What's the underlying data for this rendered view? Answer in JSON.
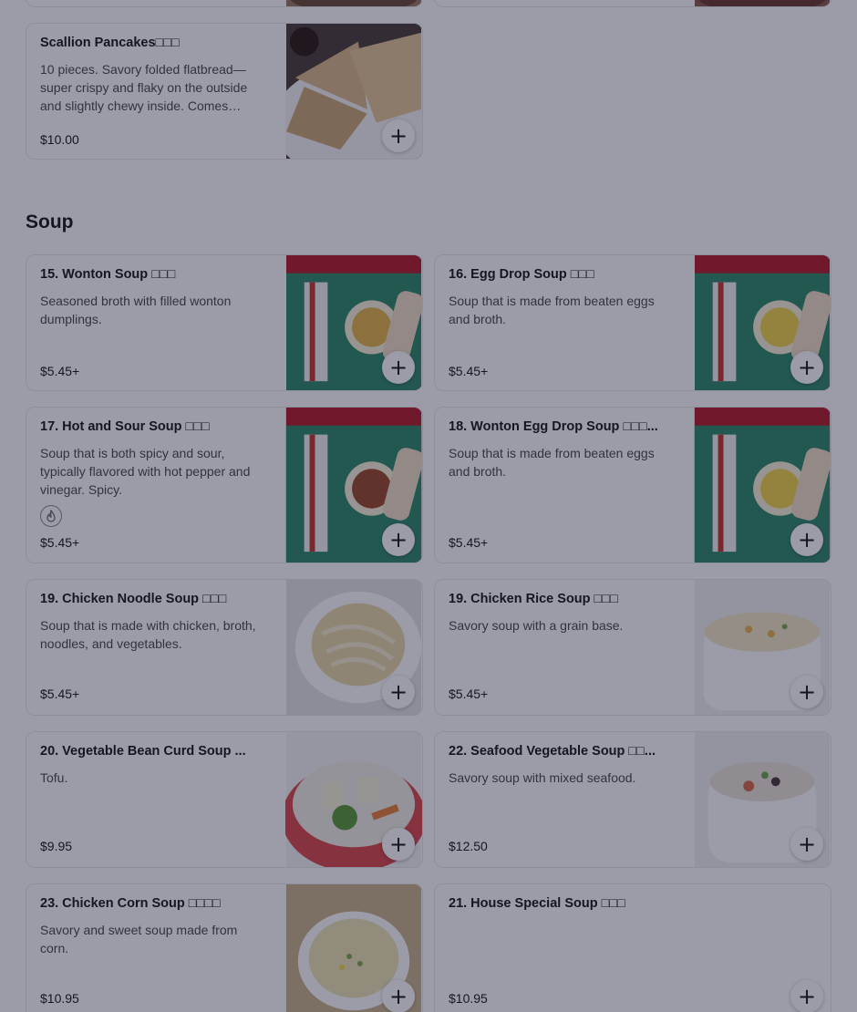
{
  "top_items": [
    {
      "name": "Scallion Pancakes   ",
      "name_suffix": "□□□",
      "description": "10 pieces. Savory folded flatbread—super crispy and flaky on the outside and slightly chewy inside. Comes…",
      "price": "$10.00"
    }
  ],
  "section": {
    "title": "Soup"
  },
  "items": [
    {
      "name": "15. Wonton Soup □□□",
      "description": "Seasoned broth with filled wonton dumplings.",
      "price": "$5.45+"
    },
    {
      "name": "16. Egg Drop Soup □□□",
      "description": "Soup that is made from beaten eggs and broth.",
      "price": "$5.45+"
    },
    {
      "name": "17. Hot and Sour Soup □□□",
      "description": "Soup that is both spicy and sour, typically flavored with hot pepper and vinegar. Spicy.",
      "price": "$5.45+"
    },
    {
      "name": "18. Wonton Egg Drop Soup □□□...",
      "description": "Soup that is made from beaten eggs and broth.",
      "price": "$5.45+"
    },
    {
      "name": "19. Chicken Noodle Soup □□□",
      "description": "Soup that is made with chicken, broth, noodles, and vegetables.",
      "price": "$5.45+"
    },
    {
      "name": "19. Chicken Rice Soup □□□",
      "description": "Savory soup with a grain base.",
      "price": "$5.45+"
    },
    {
      "name": "20. Vegetable Bean Curd Soup ...",
      "description": "Tofu.",
      "price": "$9.95"
    },
    {
      "name": "22. Seafood Vegetable Soup □□...",
      "description": "Savory soup with mixed seafood.",
      "price": "$12.50"
    },
    {
      "name": "23. Chicken Corn Soup □□□□",
      "description": "Savory and sweet soup made from corn.",
      "price": "$10.95"
    },
    {
      "name": "21. House Special Soup □□□",
      "description": "",
      "price": "$10.95"
    }
  ],
  "add_label": "+",
  "icons": {
    "add": "plus-icon",
    "spicy": "flame-icon"
  },
  "colors": {
    "tray": "#2f8a6a",
    "wall": "#b51e2a",
    "overlay": "#12122f"
  }
}
